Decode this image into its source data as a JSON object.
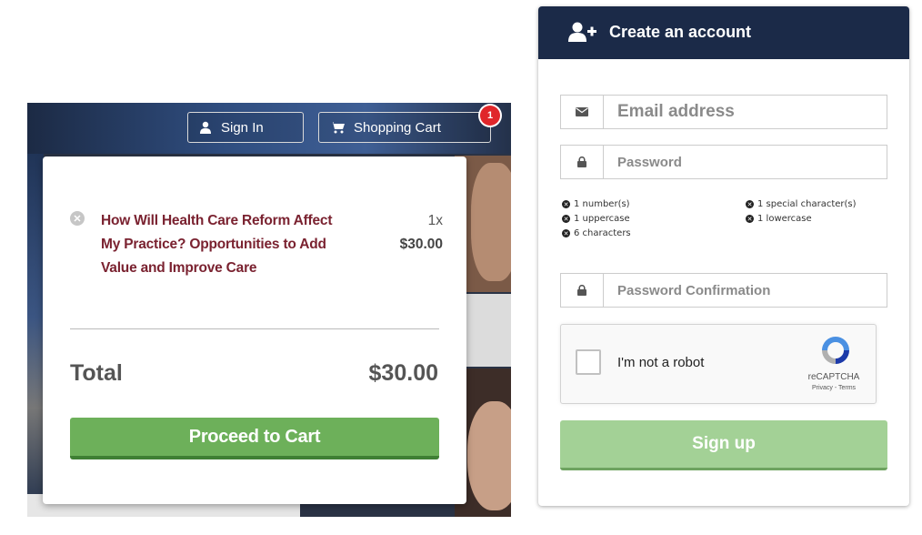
{
  "header": {
    "signin_label": "Sign In",
    "cart_label": "Shopping Cart",
    "cart_badge": "1"
  },
  "cart": {
    "items": [
      {
        "title": "How Will Health Care Reform Affect My Practice? Opportunities to Add Value and Improve Care",
        "quantity": "1x",
        "price": "$30.00"
      }
    ],
    "total_label": "Total",
    "total_value": "$30.00",
    "proceed_label": "Proceed to Cart"
  },
  "account": {
    "title": "Create an account",
    "email_placeholder": "Email address",
    "password_placeholder": "Password",
    "confirm_placeholder": "Password Confirmation",
    "rules": [
      "1 number(s)",
      "1 special character(s)",
      "1 uppercase",
      "1 lowercase",
      "6 characters"
    ],
    "captcha": {
      "label": "I'm not a robot",
      "brand": "reCAPTCHA",
      "links": "Privacy - Terms"
    },
    "signup_label": "Sign up"
  },
  "colors": {
    "navy": "#1b2a48",
    "green": "#6db05a",
    "green_light": "#a3d196",
    "maroon": "#7a2230",
    "badge_red": "#e0262a"
  },
  "icons": [
    "user-icon",
    "cart-icon",
    "remove-icon",
    "add-user-icon",
    "envelope-icon",
    "lock-icon",
    "recaptcha-logo-icon"
  ]
}
